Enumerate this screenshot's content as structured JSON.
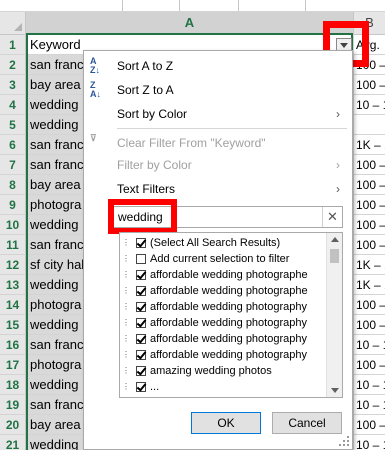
{
  "top_tabs": [
    "",
    ""
  ],
  "columns": {
    "A": "A",
    "B": "B"
  },
  "rows": [
    {
      "num": "1",
      "a": "Keyword",
      "b": "Avg."
    },
    {
      "num": "2",
      "a": "san franc",
      "b": "100 –"
    },
    {
      "num": "3",
      "a": "bay area",
      "b": "100 –"
    },
    {
      "num": "4",
      "a": "wedding",
      "b": "10 – 1"
    },
    {
      "num": "5",
      "a": "wedding",
      "b": ""
    },
    {
      "num": "6",
      "a": "san franc",
      "b": "1K – 1"
    },
    {
      "num": "7",
      "a": "san franc",
      "b": "100 –"
    },
    {
      "num": "8",
      "a": "bay area",
      "b": "100 –"
    },
    {
      "num": "9",
      "a": "photogra",
      "b": "100 –"
    },
    {
      "num": "10",
      "a": "wedding",
      "b": "100 –"
    },
    {
      "num": "11",
      "a": "san franc",
      "b": "100 –"
    },
    {
      "num": "12",
      "a": "sf city hal",
      "b": "1K – 1"
    },
    {
      "num": "13",
      "a": "wedding",
      "b": "1K – 1"
    },
    {
      "num": "14",
      "a": "photogra",
      "b": "100 –"
    },
    {
      "num": "15",
      "a": "wedding",
      "b": "100 –"
    },
    {
      "num": "16",
      "a": "san franc",
      "b": "10 – 1"
    },
    {
      "num": "17",
      "a": "photogra",
      "b": "100 –"
    },
    {
      "num": "18",
      "a": "wedding",
      "b": "10 – 1"
    },
    {
      "num": "19",
      "a": "san franc",
      "b": "10 – 1"
    },
    {
      "num": "20",
      "a": "bay area",
      "b": "100 –"
    },
    {
      "num": "21",
      "a": "wedding",
      "b": "10 – 1"
    }
  ],
  "menu": {
    "sort_az": "Sort A to Z",
    "sort_za": "Sort Z to A",
    "sort_color": "Sort by Color",
    "clear_filter": "Clear Filter From \"Keyword\"",
    "filter_color": "Filter by Color",
    "text_filters": "Text Filters",
    "search_value": "wedding",
    "clear_search": "✕",
    "list_items": [
      {
        "label": "(Select All Search Results)",
        "checked": true
      },
      {
        "label": "Add current selection to filter",
        "checked": false
      },
      {
        "label": "affordable wedding photographe",
        "checked": true
      },
      {
        "label": "affordable wedding photographe",
        "checked": true
      },
      {
        "label": "affordable wedding photography",
        "checked": true
      },
      {
        "label": "affordable wedding photography",
        "checked": true
      },
      {
        "label": "affordable wedding photography",
        "checked": true
      },
      {
        "label": "affordable wedding photography",
        "checked": true
      },
      {
        "label": "amazing wedding photos",
        "checked": true
      },
      {
        "label": "...",
        "checked": true
      }
    ],
    "ok": "OK",
    "cancel": "Cancel"
  },
  "colors": {
    "excel_green": "#217346",
    "highlight_red": "#ff0000",
    "filtered_cell_gray": "#d9d9d9"
  }
}
